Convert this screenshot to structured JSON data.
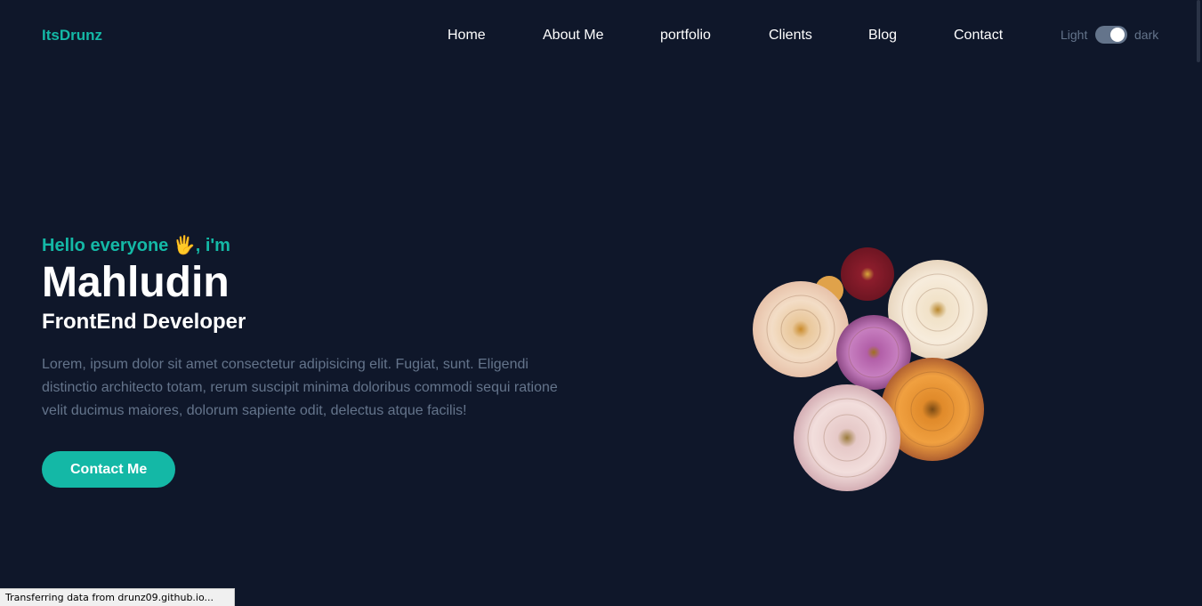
{
  "nav": {
    "logo": "ItsDrunz",
    "links": [
      "Home",
      "About Me",
      "portfolio",
      "Clients",
      "Blog",
      "Contact"
    ],
    "theme_light_label": "Light",
    "theme_dark_label": "dark"
  },
  "hero": {
    "greeting": "Hello everyone 🖐, i'm",
    "name": "Mahludin",
    "role": "FrontEnd Developer",
    "bio": "Lorem, ipsum dolor sit amet consectetur adipisicing elit. Fugiat, sunt. Eligendi distinctio architecto totam, rerum suscipit minima doloribus commodi sequi ratione velit ducimus maiores, dolorum sapiente odit, delectus atque facilis!",
    "cta_label": "Contact Me",
    "image_icon": "flower-bouquet-image"
  },
  "status_bar": {
    "text": "Transferring data from drunz09.github.io..."
  },
  "colors": {
    "background": "#0f172a",
    "accent": "#14b8a6",
    "muted_text": "#64748b",
    "text": "#ffffff"
  }
}
